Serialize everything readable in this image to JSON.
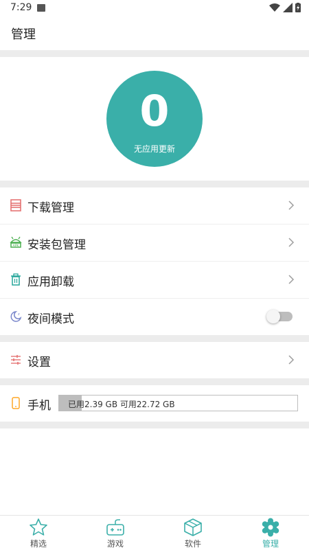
{
  "status": {
    "time": "7:29"
  },
  "header": {
    "title": "管理"
  },
  "hero": {
    "count": "0",
    "label": "无应用更新"
  },
  "menu": {
    "download": "下载管理",
    "package": "安装包管理",
    "uninstall": "应用卸载",
    "night_mode": "夜间模式",
    "settings": "设置"
  },
  "night_mode_on": false,
  "storage": {
    "label": "手机",
    "text": "已用2.39 GB  可用22.72 GB",
    "used_fraction": 0.095
  },
  "nav": {
    "items": [
      {
        "label": "精选",
        "icon": "star-icon"
      },
      {
        "label": "游戏",
        "icon": "gamepad-icon"
      },
      {
        "label": "软件",
        "icon": "box-icon"
      },
      {
        "label": "管理",
        "icon": "gear-icon"
      }
    ],
    "active_index": 3
  },
  "colors": {
    "accent": "#3aafa9",
    "download_icon": "#e57373",
    "package_icon": "#4caf50",
    "uninstall_icon": "#26a69a",
    "night_icon": "#7986cb",
    "settings_icon": "#e57373",
    "phone_icon": "#ffa726"
  }
}
